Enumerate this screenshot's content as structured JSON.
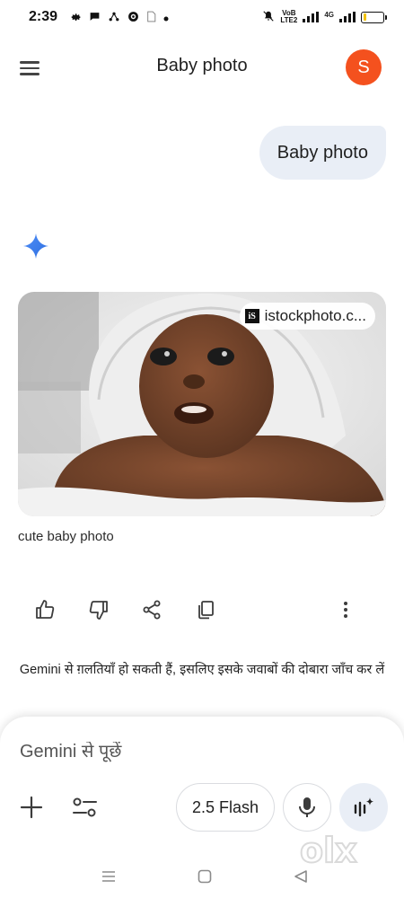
{
  "status_bar": {
    "time": "2:39",
    "network_label_top": "VoB",
    "network_label_bottom": "LTE2",
    "network_type": "4G",
    "battery_level": 0.18,
    "icons": [
      "gear-icon",
      "chat-icon",
      "network-icon",
      "vpn-icon",
      "sim-icon",
      "dot-icon",
      "mute-icon",
      "signal-icon",
      "battery-icon"
    ]
  },
  "header": {
    "title": "Baby photo",
    "avatar_letter": "S",
    "avatar_color": "#f4511e"
  },
  "conversation": {
    "user_message": "Baby photo",
    "response": {
      "image_source": "istockphoto.c...",
      "source_logo_text": "iS",
      "caption": "cute baby photo"
    }
  },
  "actions": [
    "thumbs-up-icon",
    "thumbs-down-icon",
    "share-icon",
    "copy-icon",
    "more-vert-icon"
  ],
  "disclaimer": "Gemini से ग़लतियाँ हो सकती हैं, इसलिए इसके जवाबों की दोबारा जाँच कर लें",
  "input": {
    "placeholder": "Gemini से पूछें",
    "model_label": "2.5 Flash"
  },
  "watermark_text": "olx",
  "colors": {
    "bubble_bg": "#e9eef6",
    "spark_blue": "#4285f4",
    "avatar": "#f4511e"
  }
}
